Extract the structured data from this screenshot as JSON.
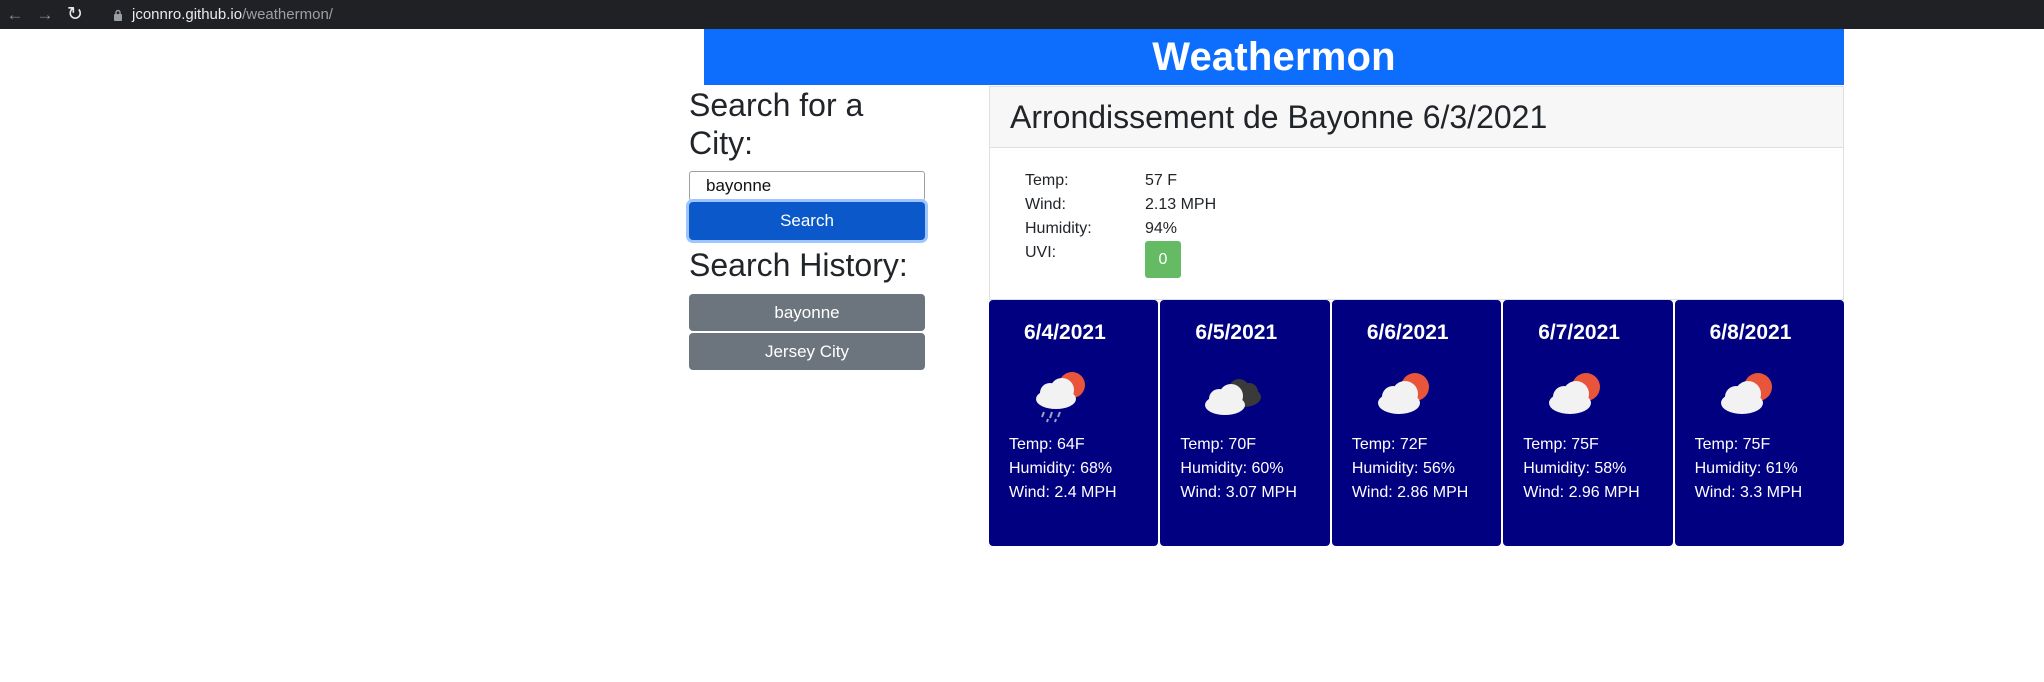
{
  "browser": {
    "url_host": "jconnro.github.io",
    "url_path": "/weathermon/"
  },
  "app": {
    "title": "Weathermon"
  },
  "search": {
    "heading": "Search for a City:",
    "input_value": "bayonne",
    "button_label": "Search"
  },
  "history": {
    "heading": "Search History:",
    "items": [
      "bayonne",
      "Jersey City"
    ]
  },
  "current": {
    "title": "Arrondissement de Bayonne 6/3/2021",
    "temp_label": "Temp:",
    "temp_value": "57 F",
    "wind_label": "Wind:",
    "wind_value": "2.13 MPH",
    "humidity_label": "Humidity:",
    "humidity_value": "94%",
    "uvi_label": "UVI:",
    "uvi_value": "0",
    "uvi_color": "#5cb85c"
  },
  "forecast": [
    {
      "date": "6/4/2021",
      "icon": "cloud-sun-rain-icon",
      "temp": "Temp: 64F",
      "humidity": "Humidity: 68%",
      "wind": "Wind: 2.4 MPH"
    },
    {
      "date": "6/5/2021",
      "icon": "cloudy-icon",
      "temp": "Temp: 70F",
      "humidity": "Humidity: 60%",
      "wind": "Wind: 3.07 MPH"
    },
    {
      "date": "6/6/2021",
      "icon": "partly-cloudy-icon",
      "temp": "Temp: 72F",
      "humidity": "Humidity: 56%",
      "wind": "Wind: 2.86 MPH"
    },
    {
      "date": "6/7/2021",
      "icon": "partly-cloudy-icon",
      "temp": "Temp: 75F",
      "humidity": "Humidity: 58%",
      "wind": "Wind: 2.96 MPH"
    },
    {
      "date": "6/8/2021",
      "icon": "partly-cloudy-icon",
      "temp": "Temp: 75F",
      "humidity": "Humidity: 61%",
      "wind": "Wind: 3.3 MPH"
    }
  ],
  "colors": {
    "header_bg": "#0d6efd",
    "search_btn": "#0a58ca",
    "history_btn": "#6c757d",
    "forecast_bg": "#000080"
  }
}
